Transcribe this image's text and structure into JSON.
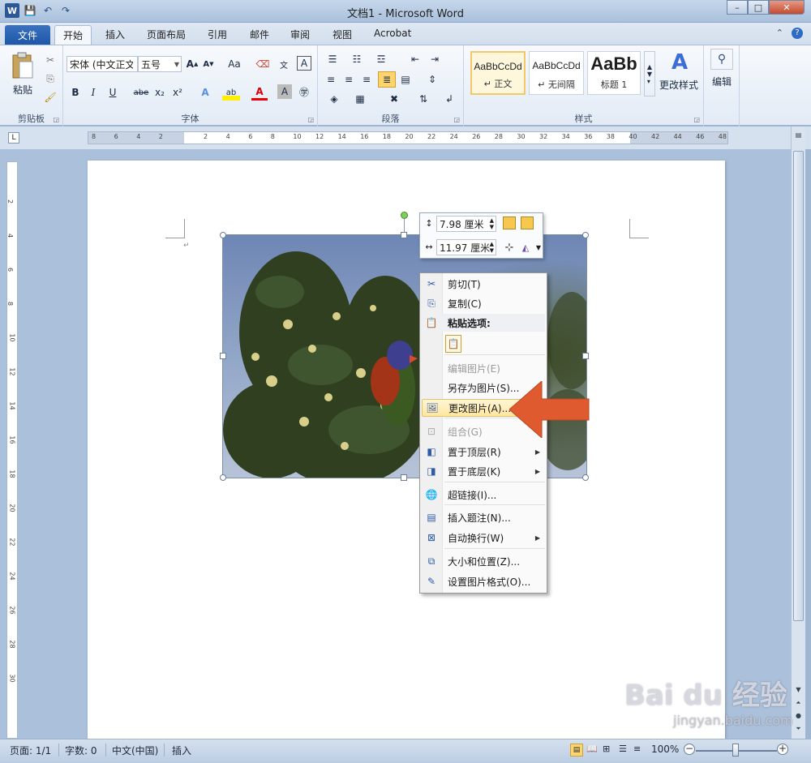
{
  "window": {
    "title": "文档1 - Microsoft Word",
    "controls": [
      "–",
      "□",
      "✕"
    ]
  },
  "quick_access": [
    "W",
    "💾",
    "↶",
    "↷"
  ],
  "tabs": [
    "文件",
    "开始",
    "插入",
    "页面布局",
    "引用",
    "邮件",
    "审阅",
    "视图",
    "Acrobat"
  ],
  "ribbon": {
    "clipboard": {
      "paste_label": "粘贴",
      "group_label": "剪贴板"
    },
    "font": {
      "font_name": "宋体 (中文正文)",
      "font_size": "五号",
      "group_label": "字体",
      "buttons": [
        "B",
        "I",
        "U",
        "abe",
        "x₂",
        "x²",
        "A",
        "ab",
        "A",
        "A",
        "㊫"
      ]
    },
    "paragraph": {
      "group_label": "段落"
    },
    "styles": {
      "group_label": "样式",
      "items": [
        {
          "sample": "AaBbCcDd",
          "name": "↵ 正文"
        },
        {
          "sample": "AaBbCcDd",
          "name": "↵ 无间隔"
        },
        {
          "sample": "AaBb",
          "name": "标题 1"
        }
      ],
      "change_styles": "更改样式"
    },
    "editing": {
      "label": "编辑"
    }
  },
  "ruler": {
    "h_ticks": [
      "8",
      "6",
      "4",
      "2",
      "",
      "2",
      "4",
      "6",
      "8",
      "10",
      "12",
      "14",
      "16",
      "18",
      "20",
      "22",
      "24",
      "26",
      "28",
      "30",
      "32",
      "34",
      "36",
      "38",
      "40",
      "42",
      "44",
      "46",
      "48"
    ],
    "v_ticks": [
      "2",
      "4",
      "6",
      "8",
      "10",
      "12",
      "14",
      "16",
      "18",
      "20",
      "22",
      "24",
      "26",
      "28",
      "30"
    ]
  },
  "mini_toolbar": {
    "height": "7.98 厘米",
    "width": "11.97 厘米"
  },
  "context_menu": {
    "items": [
      {
        "label": "剪切(T)",
        "icon": "scissors-icon",
        "glyph": "✂"
      },
      {
        "label": "复制(C)",
        "icon": "copy-icon",
        "glyph": "⎘"
      },
      {
        "label": "粘贴选项:",
        "icon": "paste-icon",
        "glyph": "📋"
      },
      {
        "label": "编辑图片(E)",
        "icon": "edit-picture-icon",
        "glyph": ""
      },
      {
        "label": "另存为图片(S)...",
        "icon": "save-as-picture-icon",
        "glyph": ""
      },
      {
        "label": "更改图片(A)...",
        "icon": "change-picture-icon",
        "glyph": "🖼"
      },
      {
        "label": "组合(G)",
        "icon": "group-icon",
        "glyph": "⊡"
      },
      {
        "label": "置于顶层(R)",
        "icon": "bring-to-front-icon",
        "glyph": "◧"
      },
      {
        "label": "置于底层(K)",
        "icon": "send-to-back-icon",
        "glyph": "◨"
      },
      {
        "label": "超链接(I)...",
        "icon": "hyperlink-icon",
        "glyph": "🌐"
      },
      {
        "label": "插入题注(N)...",
        "icon": "caption-icon",
        "glyph": "▤"
      },
      {
        "label": "自动换行(W)",
        "icon": "text-wrap-icon",
        "glyph": "⊠"
      },
      {
        "label": "大小和位置(Z)...",
        "icon": "size-position-icon",
        "glyph": "⧉"
      },
      {
        "label": "设置图片格式(O)...",
        "icon": "format-picture-icon",
        "glyph": "✎"
      }
    ]
  },
  "status_bar": {
    "page": "页面: 1/1",
    "words": "字数: 0",
    "language": "中文(中国)",
    "mode": "插入",
    "zoom": "100%"
  },
  "watermark": {
    "main": "Bai du 经验",
    "sub": "jingyan.baidu.com"
  }
}
